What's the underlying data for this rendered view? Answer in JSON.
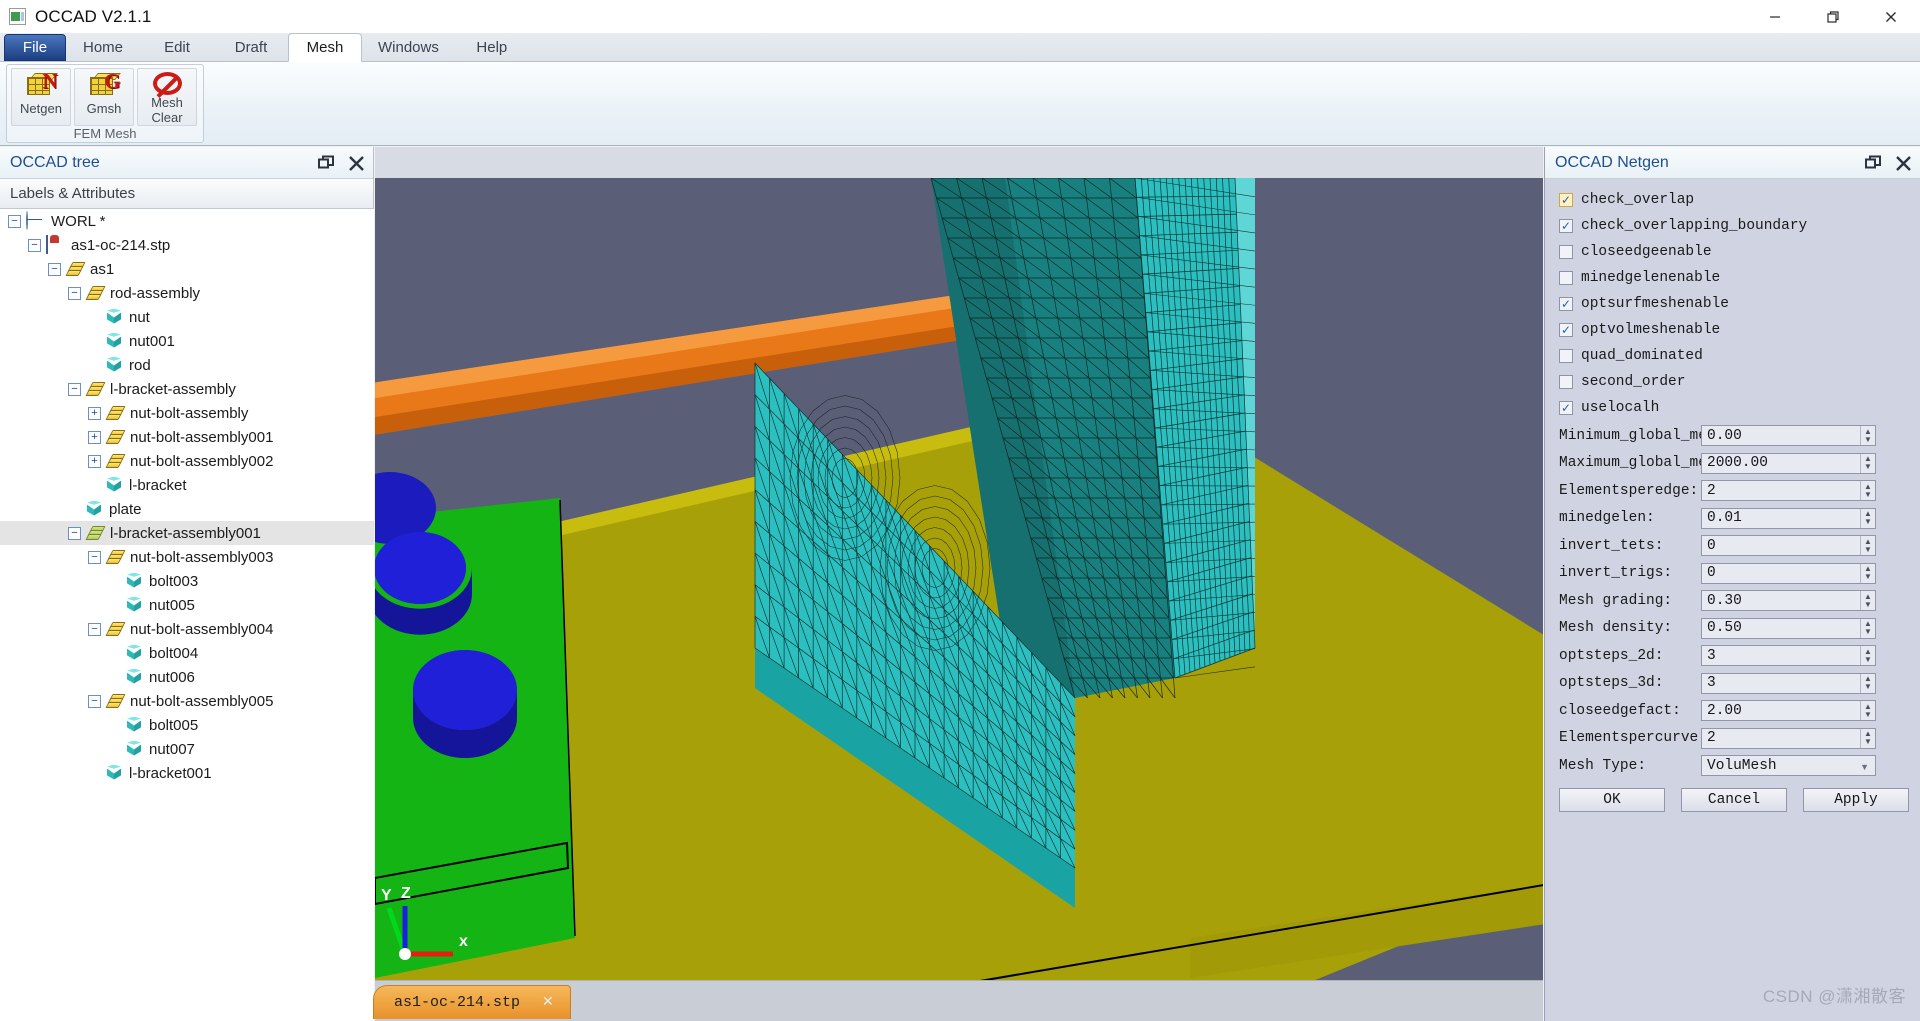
{
  "window": {
    "title": "OCCAD V2.1.1",
    "app_icon": "app-icon",
    "minimize": "—",
    "maximize": "❐",
    "close": "✕"
  },
  "ribbon": {
    "tabs": [
      {
        "label": "File",
        "kind": "file"
      },
      {
        "label": "Home",
        "kind": "normal"
      },
      {
        "label": "Edit",
        "kind": "normal"
      },
      {
        "label": "Draft",
        "kind": "normal"
      },
      {
        "label": "Mesh",
        "kind": "active"
      },
      {
        "label": "Windows",
        "kind": "normal"
      },
      {
        "label": "Help",
        "kind": "normal"
      }
    ],
    "group": {
      "title": "FEM Mesh",
      "items": [
        {
          "label": "Netgen",
          "icon": "netgen-mesh-cube-icon",
          "letter": "N"
        },
        {
          "label": "Gmsh",
          "icon": "gmsh-mesh-cube-icon",
          "letter": "G"
        },
        {
          "label": "Mesh\nClear",
          "label_line1": "Mesh",
          "label_line2": "Clear",
          "icon": "no-entry-icon"
        }
      ]
    }
  },
  "left_panel": {
    "title": "OCCAD tree",
    "column_header": "Labels & Attributes",
    "undock": "❐",
    "close": "✕",
    "tree": [
      {
        "label": "WORL *",
        "depth": 0,
        "toggle": "minus",
        "icon": "globe"
      },
      {
        "label": "as1-oc-214.stp",
        "depth": 1,
        "toggle": "minus",
        "icon": "step"
      },
      {
        "label": "as1",
        "depth": 2,
        "toggle": "minus",
        "icon": "assembly"
      },
      {
        "label": "rod-assembly",
        "depth": 3,
        "toggle": "minus",
        "icon": "assembly"
      },
      {
        "label": "nut",
        "depth": 4,
        "toggle": "none",
        "icon": "part"
      },
      {
        "label": "nut001",
        "depth": 4,
        "toggle": "none",
        "icon": "part"
      },
      {
        "label": "rod",
        "depth": 4,
        "toggle": "none",
        "icon": "part"
      },
      {
        "label": "l-bracket-assembly",
        "depth": 3,
        "toggle": "minus",
        "icon": "assembly"
      },
      {
        "label": "nut-bolt-assembly",
        "depth": 4,
        "toggle": "plus",
        "icon": "assembly"
      },
      {
        "label": "nut-bolt-assembly001",
        "depth": 4,
        "toggle": "plus",
        "icon": "assembly"
      },
      {
        "label": "nut-bolt-assembly002",
        "depth": 4,
        "toggle": "plus",
        "icon": "assembly"
      },
      {
        "label": "l-bracket",
        "depth": 4,
        "toggle": "none",
        "icon": "part"
      },
      {
        "label": "plate",
        "depth": 3,
        "toggle": "none",
        "icon": "part"
      },
      {
        "label": "l-bracket-assembly001",
        "depth": 3,
        "toggle": "minus",
        "icon": "assembly-green",
        "selected": true
      },
      {
        "label": "nut-bolt-assembly003",
        "depth": 4,
        "toggle": "minus",
        "icon": "assembly"
      },
      {
        "label": "bolt003",
        "depth": 5,
        "toggle": "none",
        "icon": "part"
      },
      {
        "label": "nut005",
        "depth": 5,
        "toggle": "none",
        "icon": "part"
      },
      {
        "label": "nut-bolt-assembly004",
        "depth": 4,
        "toggle": "minus",
        "icon": "assembly"
      },
      {
        "label": "bolt004",
        "depth": 5,
        "toggle": "none",
        "icon": "part"
      },
      {
        "label": "nut006",
        "depth": 5,
        "toggle": "none",
        "icon": "part"
      },
      {
        "label": "nut-bolt-assembly005",
        "depth": 4,
        "toggle": "minus",
        "icon": "assembly"
      },
      {
        "label": "bolt005",
        "depth": 5,
        "toggle": "none",
        "icon": "part"
      },
      {
        "label": "nut007",
        "depth": 5,
        "toggle": "none",
        "icon": "part"
      },
      {
        "label": "l-bracket001",
        "depth": 4,
        "toggle": "none",
        "icon": "part"
      }
    ]
  },
  "viewport": {
    "background_color": "#5a5f77",
    "axis_indicator": {
      "x": "x",
      "y": "Y",
      "z": "Z",
      "x_color": "#e81d0e",
      "y_color": "#00d81d",
      "z_color": "#1a20e0"
    },
    "colors": {
      "plate_olive": "#a8a008",
      "bracket_green": "#14b414",
      "rod_orange": "#e87818",
      "bolt_blue": "#1b1bbe",
      "mesh_cyan": "#2bbfbf",
      "mesh_dark_cyan": "#18807f",
      "mesh_light_cyan": "#5fd6d6"
    },
    "document_tab": {
      "label": "as1-oc-214.stp",
      "close": "✕"
    }
  },
  "right_panel": {
    "title": "OCCAD Netgen",
    "undock": "❐",
    "close": "✕",
    "checkboxes": [
      {
        "label": "check_overlap",
        "checked": true,
        "highlight": true
      },
      {
        "label": "check_overlapping_boundary",
        "checked": true,
        "highlight": false
      },
      {
        "label": "closeedgeenable",
        "checked": false,
        "highlight": false
      },
      {
        "label": "minedgelenenable",
        "checked": false,
        "highlight": false
      },
      {
        "label": "optsurfmeshenable",
        "checked": true,
        "highlight": false
      },
      {
        "label": "optvolmeshenable",
        "checked": true,
        "highlight": false
      },
      {
        "label": "quad_dominated",
        "checked": false,
        "highlight": false
      },
      {
        "label": "second_order",
        "checked": false,
        "highlight": false
      },
      {
        "label": "uselocalh",
        "checked": true,
        "highlight": false
      }
    ],
    "fields": [
      {
        "label": "Minimum_global_mesh:",
        "value": "0.00",
        "type": "spin"
      },
      {
        "label": "Maximum_global_mesh:",
        "value": "2000.00",
        "type": "spin"
      },
      {
        "label": "Elementsperedge:",
        "value": "2",
        "type": "spin"
      },
      {
        "label": "minedgelen:",
        "value": "0.01",
        "type": "spin"
      },
      {
        "label": "invert_tets:",
        "value": "0",
        "type": "spin"
      },
      {
        "label": "invert_trigs:",
        "value": "0",
        "type": "spin"
      },
      {
        "label": "Mesh grading:",
        "value": "0.30",
        "type": "spin"
      },
      {
        "label": "Mesh density:",
        "value": "0.50",
        "type": "spin"
      },
      {
        "label": "optsteps_2d:",
        "value": "3",
        "type": "spin"
      },
      {
        "label": "optsteps_3d:",
        "value": "3",
        "type": "spin"
      },
      {
        "label": "closeedgefact:",
        "value": "2.00",
        "type": "spin"
      },
      {
        "label": "Elementspercurve:",
        "value": "2",
        "type": "spin"
      },
      {
        "label": "Mesh Type:",
        "value": "VoluMesh",
        "type": "combo"
      }
    ],
    "buttons": [
      {
        "label": "OK"
      },
      {
        "label": "Cancel"
      },
      {
        "label": "Apply"
      }
    ]
  },
  "watermark": {
    "text": "CSDN @潇湘散客"
  }
}
